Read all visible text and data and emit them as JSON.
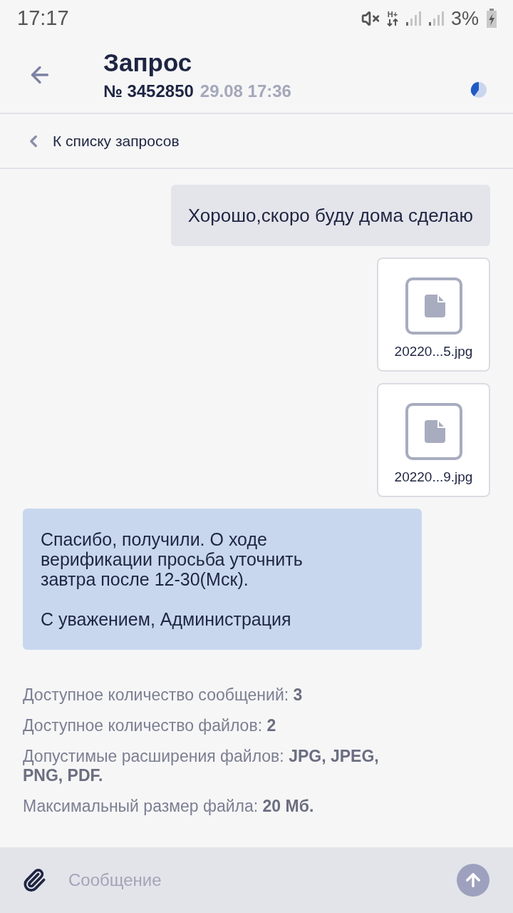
{
  "status_bar": {
    "time": "17:17",
    "network": "H+",
    "battery": "3%"
  },
  "header": {
    "title": "Запрос",
    "number": "№ 3452850",
    "datetime": "29.08 17:36"
  },
  "back_link": {
    "label": "К списку запросов"
  },
  "messages": [
    {
      "kind": "text",
      "outgoing": true,
      "paragraphs": [
        "Хорошо,скоро буду дома сделаю"
      ]
    },
    {
      "kind": "file",
      "outgoing": true,
      "name": "20220...5.jpg"
    },
    {
      "kind": "file",
      "outgoing": true,
      "name": "20220...9.jpg"
    },
    {
      "kind": "text",
      "outgoing": false,
      "paragraphs": [
        "Спасибо, получили. О ходе верификации просьба уточнить завтра после 12-30(Мск).",
        "С уважением, Администрация"
      ]
    }
  ],
  "limits": [
    "Доступное количество сообщений: **3**",
    "Доступное количество файлов: **2**",
    "Допустимые расширения файлов: **JPG, JPEG, PNG, PDF.**",
    "Максимальный размер файла: **20 Мб.**"
  ],
  "composer": {
    "placeholder": "Сообщение"
  }
}
